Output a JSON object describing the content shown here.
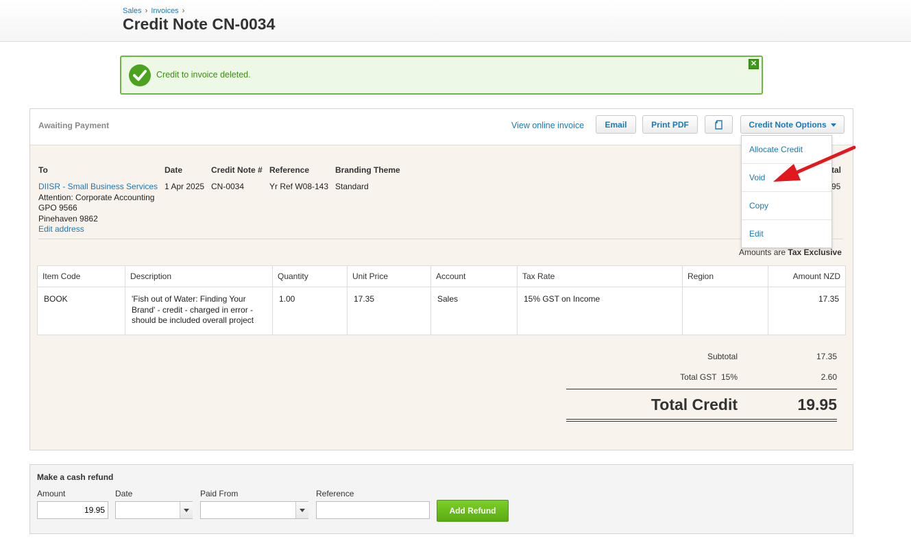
{
  "breadcrumb": {
    "sales": "Sales",
    "invoices": "Invoices",
    "sep": "›"
  },
  "page_title": "Credit Note CN-0034",
  "notice": {
    "message": "Credit to invoice deleted.",
    "close": "✕"
  },
  "toolbar": {
    "status": "Awaiting Payment",
    "view_online": "View online invoice",
    "email": "Email",
    "print_pdf": "Print PDF",
    "options": "Credit Note Options"
  },
  "details": {
    "to_label": "To",
    "date_label": "Date",
    "number_label": "Credit Note #",
    "reference_label": "Reference",
    "theme_label": "Branding Theme",
    "total_label_partial": "tal",
    "total_value_partial": "95",
    "contact": "DIISR - Small Business Services",
    "address": [
      "Attention: Corporate Accounting",
      "GPO 9566",
      "Pinehaven 9862"
    ],
    "edit_address": "Edit address",
    "date": "1 Apr 2025",
    "number": "CN-0034",
    "reference": "Yr Ref W08-143",
    "theme": "Standard"
  },
  "tax_note": {
    "prefix": "Amounts are",
    "mode": "Tax Exclusive"
  },
  "table": {
    "headers": [
      "Item Code",
      "Description",
      "Quantity",
      "Unit Price",
      "Account",
      "Tax Rate",
      "Region",
      "Amount NZD"
    ],
    "rows": [
      [
        "BOOK",
        "'Fish out of Water: Finding Your Brand' - credit - charged in error - should be included overall project",
        "1.00",
        "17.35",
        "Sales",
        "15% GST on Income",
        "",
        "17.35"
      ]
    ]
  },
  "totals": {
    "subtotal_label": "Subtotal",
    "subtotal": "17.35",
    "gst_label": "Total GST  15%",
    "gst": "2.60",
    "total_label": "Total Credit",
    "total": "19.95"
  },
  "dropdown": [
    "Allocate Credit",
    "Void",
    "Copy",
    "Edit"
  ],
  "refund": {
    "title": "Make a cash refund",
    "amount_label": "Amount",
    "date_label": "Date",
    "paid_from_label": "Paid From",
    "reference_label": "Reference",
    "amount_value": "19.95",
    "button": "Add Refund"
  },
  "colors": {
    "link": "#1a78b5",
    "success": "#4aa21f",
    "arrow": "#e0191e"
  }
}
